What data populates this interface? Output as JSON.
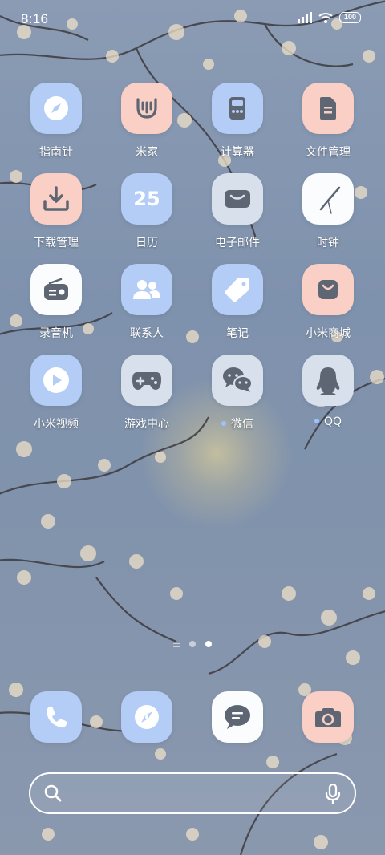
{
  "status_bar": {
    "time": "8:16",
    "battery": "100"
  },
  "apps": [
    {
      "label": "指南针",
      "icon": "compass-icon",
      "bg": "#b4cdf6",
      "indicator": false
    },
    {
      "label": "米家",
      "icon": "mijia-icon",
      "bg": "#f9cfc6",
      "indicator": false
    },
    {
      "label": "计算器",
      "icon": "calculator-icon",
      "bg": "#b4cdf6",
      "indicator": false
    },
    {
      "label": "文件管理",
      "icon": "file-icon",
      "bg": "#f9cfc6",
      "indicator": false
    },
    {
      "label": "下载管理",
      "icon": "download-icon",
      "bg": "#f9cfc6",
      "indicator": false
    },
    {
      "label": "日历",
      "icon": "calendar-icon",
      "icon_text": "25",
      "bg": "#b4cdf6",
      "indicator": false
    },
    {
      "label": "电子邮件",
      "icon": "mail-icon",
      "bg": "#d8e0ec",
      "indicator": false
    },
    {
      "label": "时钟",
      "icon": "clock-icon",
      "bg": "#fbfcfe",
      "indicator": false
    },
    {
      "label": "录音机",
      "icon": "recorder-icon",
      "bg": "#fbfcfe",
      "indicator": false
    },
    {
      "label": "联系人",
      "icon": "contacts-icon",
      "bg": "#b4cdf6",
      "indicator": false
    },
    {
      "label": "笔记",
      "icon": "notes-icon",
      "bg": "#b4cdf6",
      "indicator": false
    },
    {
      "label": "小米商城",
      "icon": "shopping-bag-icon",
      "bg": "#f9cfc6",
      "indicator": false
    },
    {
      "label": "小米视频",
      "icon": "video-play-icon",
      "bg": "#b4cdf6",
      "indicator": false
    },
    {
      "label": "游戏中心",
      "icon": "gamepad-icon",
      "bg": "#d8e0ec",
      "indicator": false
    },
    {
      "label": "微信",
      "icon": "wechat-icon",
      "bg": "#d8e0ec",
      "indicator": true
    },
    {
      "label": "QQ",
      "icon": "qq-penguin-icon",
      "bg": "#d8e0ec",
      "indicator": true
    }
  ],
  "dock": [
    {
      "icon": "phone-icon",
      "bg": "#b4cdf6"
    },
    {
      "icon": "browser-icon",
      "bg": "#b4cdf6"
    },
    {
      "icon": "messages-icon",
      "bg": "#fbfcfe"
    },
    {
      "icon": "camera-icon",
      "bg": "#f9cfc6"
    }
  ],
  "page_indicator": {
    "pages": 2,
    "current": 2
  },
  "colors": {
    "icon_glyph_blue": "#ffffff",
    "icon_glyph_gray": "#5e6674",
    "notification_dot": "#9cc2ff"
  }
}
